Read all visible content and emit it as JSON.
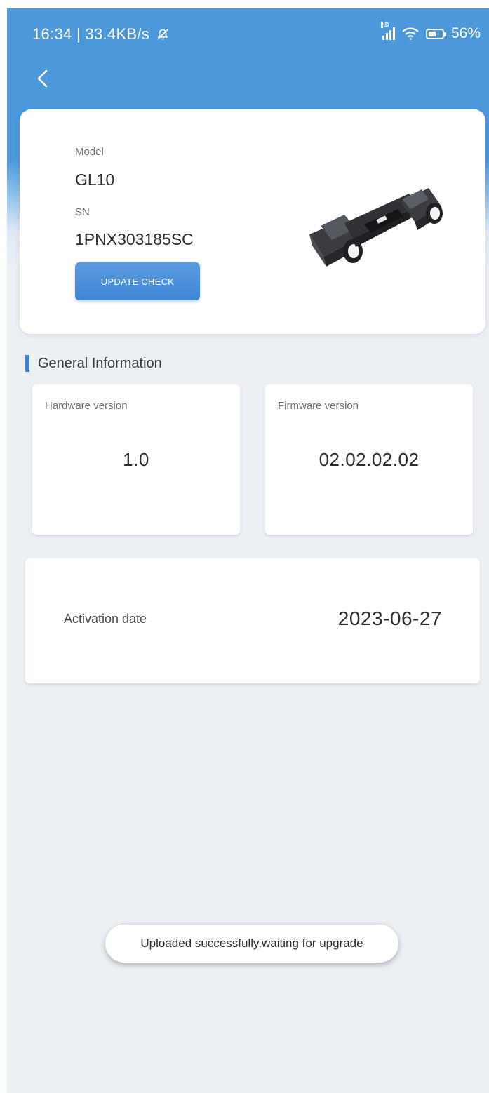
{
  "status_bar": {
    "time": "16:34",
    "network_speed": "33.4KB/s",
    "separator": "|",
    "battery_percent": 56,
    "battery_label": "56%",
    "signal_tag": "HD",
    "icons": [
      "mute-icon",
      "signal-icon",
      "wifi-icon",
      "battery-icon"
    ]
  },
  "nav": {
    "back_icon": "chevron-left-icon"
  },
  "device": {
    "model_label": "Model",
    "model_value": "GL10",
    "sn_label": "SN",
    "sn_value": "1PNX303185SC",
    "update_button": "UPDATE CHECK",
    "image": "device-image"
  },
  "general": {
    "title": "General Information",
    "hardware_label": "Hardware version",
    "hardware_value": "1.0",
    "firmware_label": "Firmware version",
    "firmware_value": "02.02.02.02",
    "activation_label": "Activation date",
    "activation_value": "2023-06-27"
  },
  "toast": {
    "message": "Uploaded successfully,waiting for upgrade"
  },
  "colors": {
    "header_blue": "#4d97db",
    "accent": "#3f7fd0",
    "background": "#eceff4",
    "card": "#ffffff",
    "text": "#2b2d31"
  }
}
